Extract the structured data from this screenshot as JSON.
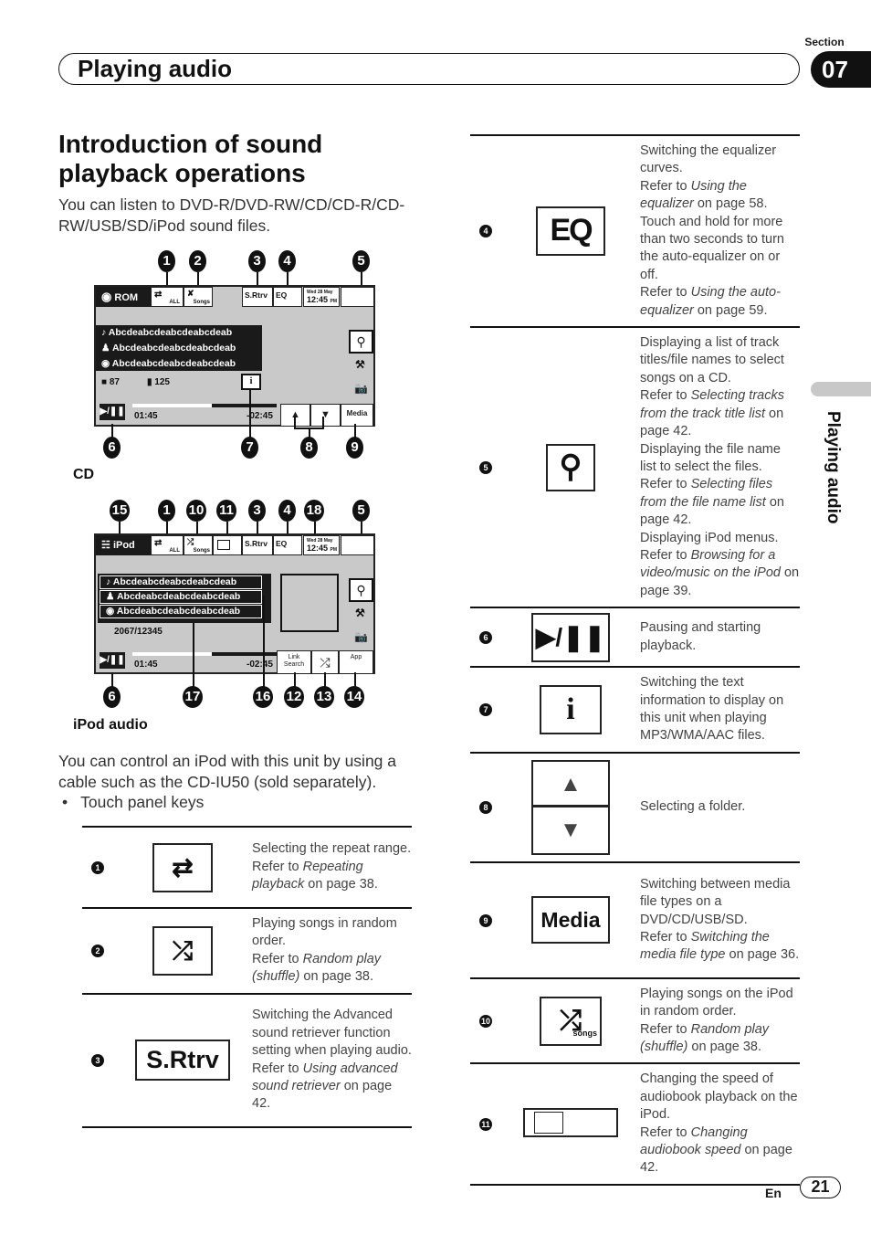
{
  "header": {
    "section_label": "Section",
    "section_number": "07",
    "title": "Playing audio",
    "side_tab": "Playing audio"
  },
  "intro": {
    "title": "Introduction of sound playback operations",
    "text": "You can listen to DVD-R/DVD-RW/CD/CD-R/CD-RW/USB/SD/iPod sound files."
  },
  "cd_screen": {
    "caption": "CD",
    "source": "ROM",
    "repeat_label": "ALL",
    "shuffle_label": "Songs",
    "srtrv_label": "S.Rtrv",
    "eq_label": "EQ",
    "date": "Wed 28 May",
    "time": "12:45",
    "ampm": "PM",
    "tracks": [
      "Abcdeabcdeabcdeabcdeab",
      "Abcdeabcdeabcdeabcdeab",
      "Abcdeabcdeabcdeabcdeab"
    ],
    "folder_count": "87",
    "file_count": "125",
    "elapsed": "01:45",
    "remaining": "-02:45",
    "progress": 0.55,
    "media_label": "Media",
    "callouts_top": [
      "1",
      "2",
      "3",
      "4",
      "5"
    ],
    "callouts_bottom": [
      "6",
      "7",
      "8",
      "9"
    ]
  },
  "ipod_screen": {
    "caption": "iPod audio",
    "source": "iPod",
    "repeat_label": "ALL",
    "shuffle_label": "Songs",
    "srtrv_label": "S.Rtrv",
    "eq_label": "EQ",
    "date": "Wed 28 May",
    "time": "12:45",
    "ampm": "PM",
    "tracks": [
      "Abcdeabcdeabcdeabcdeab",
      "Abcdeabcdeabcdeabcdeab",
      "Abcdeabcdeabcdeabcdeab"
    ],
    "track_count": "2067/12345",
    "elapsed": "01:45",
    "remaining": "-02:45",
    "progress": 0.55,
    "link_label": "Link",
    "search_label": "Search",
    "app_label": "App",
    "callouts_top": [
      "15",
      "1",
      "10",
      "11",
      "3",
      "4",
      "18",
      "5"
    ],
    "callouts_bottom": [
      "6",
      "17",
      "16",
      "12",
      "13",
      "14"
    ]
  },
  "ipod_text": "You can control an iPod with this unit by using a cable such as the CD-IU50 (sold separately).",
  "bullet": "Touch panel keys",
  "keys_left": [
    {
      "num": "1",
      "icon": "repeat-icon",
      "desc": "Selecting the repeat range.",
      "ref_pre": "Refer to ",
      "ref": "Repeating playback",
      "ref_post": " on page 38."
    },
    {
      "num": "2",
      "icon": "shuffle-icon",
      "desc": "Playing songs in random order.",
      "ref_pre": "Refer to ",
      "ref": "Random play (shuffle)",
      "ref_post": " on page 38."
    },
    {
      "num": "3",
      "icon": "S.Rtrv",
      "desc": "Switching the Advanced sound retriever function setting when playing audio.",
      "ref_pre": "Refer to ",
      "ref": "Using advanced sound retriever",
      "ref_post": " on page 42."
    }
  ],
  "keys_right": [
    {
      "num": "4",
      "icon": "EQ",
      "desc": "Switching the equalizer curves.",
      "ref_pre": "Refer to ",
      "ref": "Using the equalizer",
      "ref_post": " on page 58.",
      "desc2": "Touch and hold for more than two seconds to turn the auto-equalizer on or off.",
      "ref2": "Using the auto-equalizer",
      "ref2_post": " on page 59."
    },
    {
      "num": "5",
      "icon": "search-icon",
      "desc": "Displaying a list of track titles/file names to select songs on a CD.",
      "ref_pre": "Refer to ",
      "ref": "Selecting tracks from the track title list",
      "ref_post": " on page 42.",
      "desc2": "Displaying the file name list to select the files.",
      "ref2": "Selecting files from the file name list",
      "ref2_post": " on page 42.",
      "desc3": "Displaying iPod menus.",
      "ref3": "Browsing for a video/music on the iPod",
      "ref3_post": " on page 39."
    },
    {
      "num": "6",
      "icon": "play-pause-icon",
      "desc": "Pausing and starting playback."
    },
    {
      "num": "7",
      "icon": "info-icon",
      "desc": "Switching the text information to display on this unit when playing MP3/WMA/AAC files."
    },
    {
      "num": "8",
      "icon": "folder-up-down-icon",
      "desc": "Selecting a folder."
    },
    {
      "num": "9",
      "icon": "Media",
      "desc": "Switching between media file types on a DVD/CD/USB/SD.",
      "ref_pre": "Refer to ",
      "ref": "Switching the media file type",
      "ref_post": " on page 36."
    },
    {
      "num": "10",
      "icon": "shuffle-songs-icon",
      "icon_label": "songs",
      "desc": "Playing songs on the iPod in random order.",
      "ref_pre": "Refer to ",
      "ref": "Random play (shuffle)",
      "ref_post": " on page 38."
    },
    {
      "num": "11",
      "icon": "audiobook-speed-icon",
      "desc": "Changing the speed of audiobook playback on the iPod.",
      "ref_pre": "Refer to ",
      "ref": "Changing audiobook speed",
      "ref_post": " on page 42."
    }
  ],
  "footer": {
    "lang": "En",
    "page": "21"
  }
}
